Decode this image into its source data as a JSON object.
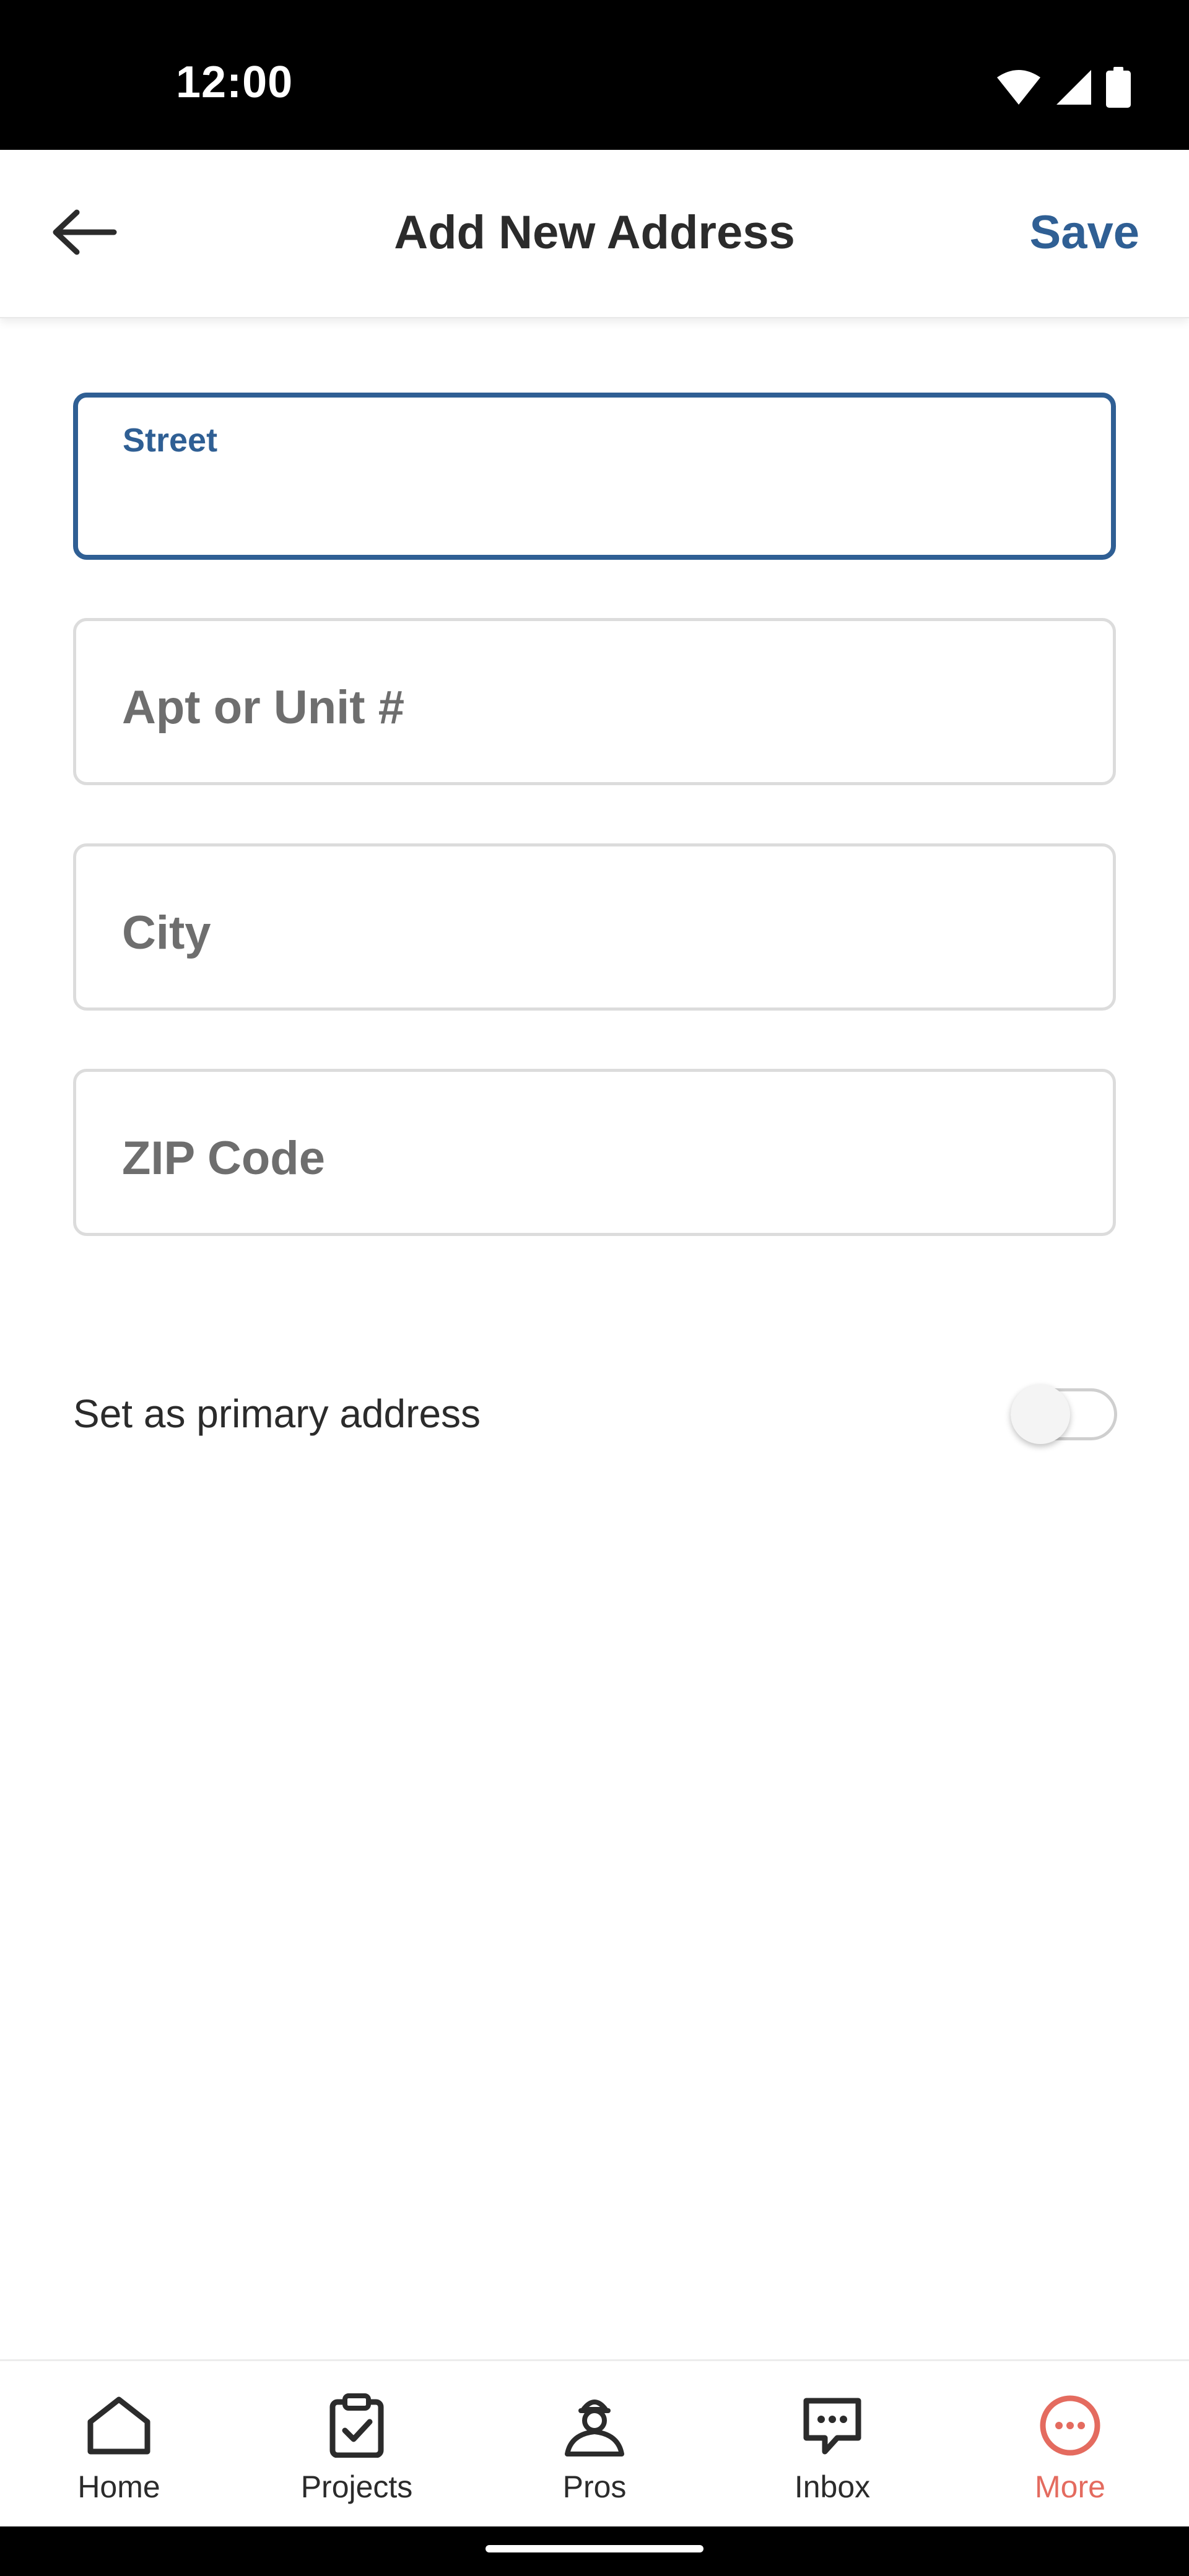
{
  "status_bar": {
    "time": "12:00"
  },
  "app_bar": {
    "title": "Add New Address",
    "save_label": "Save"
  },
  "form": {
    "street": {
      "label": "Street",
      "value": ""
    },
    "apt": {
      "placeholder": "Apt or Unit #"
    },
    "city": {
      "placeholder": "City"
    },
    "zip": {
      "placeholder": "ZIP Code"
    }
  },
  "primary_toggle": {
    "label": "Set as primary address",
    "on": false
  },
  "bottom_nav": {
    "items": [
      {
        "label": "Home",
        "icon": "home-icon"
      },
      {
        "label": "Projects",
        "icon": "clipboard-check-icon"
      },
      {
        "label": "Pros",
        "icon": "pro-person-icon"
      },
      {
        "label": "Inbox",
        "icon": "chat-bubble-icon"
      },
      {
        "label": "More",
        "icon": "more-dots-icon"
      }
    ],
    "active": "More"
  },
  "colors": {
    "accent": "#2f5f94",
    "active_nav": "#e46b5f"
  }
}
